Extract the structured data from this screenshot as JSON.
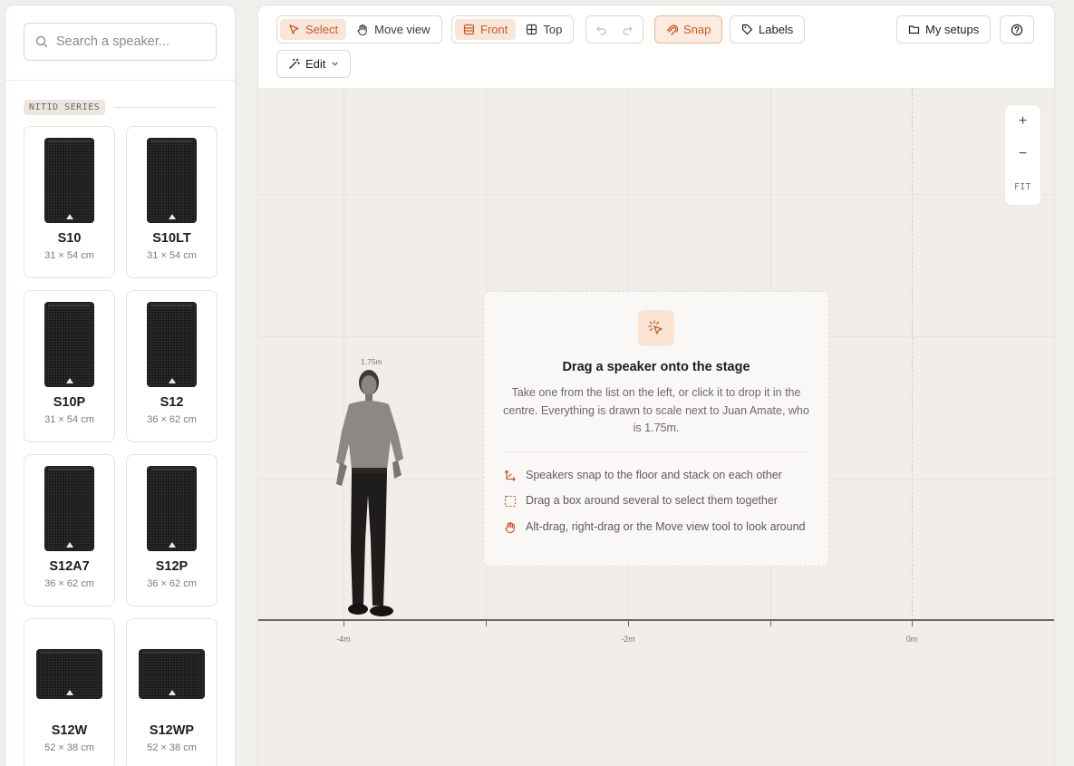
{
  "sidebar": {
    "search_placeholder": "Search a speaker...",
    "series_label": "NITID SERIES",
    "items": [
      {
        "name": "S10",
        "dims": "31 × 54 cm",
        "shape": "tall"
      },
      {
        "name": "S10LT",
        "dims": "31 × 54 cm",
        "shape": "tall"
      },
      {
        "name": "S10P",
        "dims": "31 × 54 cm",
        "shape": "tall"
      },
      {
        "name": "S12",
        "dims": "36 × 62 cm",
        "shape": "tall"
      },
      {
        "name": "S12A7",
        "dims": "36 × 62 cm",
        "shape": "tall"
      },
      {
        "name": "S12P",
        "dims": "36 × 62 cm",
        "shape": "tall"
      },
      {
        "name": "S12W",
        "dims": "52 × 38 cm",
        "shape": "wide"
      },
      {
        "name": "S12WP",
        "dims": "52 × 38 cm",
        "shape": "wide"
      }
    ]
  },
  "toolbar": {
    "select": "Select",
    "move_view": "Move view",
    "front": "Front",
    "top": "Top",
    "snap": "Snap",
    "labels": "Labels",
    "my_setups": "My setups",
    "edit": "Edit"
  },
  "zoom": {
    "in": "+",
    "out": "−",
    "fit": "FIT"
  },
  "stage": {
    "axis_labels": [
      "-4m",
      "-2m",
      "0m"
    ],
    "person_height_label": "1.75m"
  },
  "empty_state": {
    "title": "Drag a speaker onto the stage",
    "description": "Take one from the list on the left, or click it to drop it in the centre. Everything is drawn to scale next to Juan Amate, who is 1.75m.",
    "tips": [
      "Speakers snap to the floor and stack on each other",
      "Drag a box around several to select them together",
      "Alt-drag, right-drag or the Move view tool to look around"
    ]
  },
  "colors": {
    "accent": "#c45d25",
    "accent_bg": "#f9e6d9"
  }
}
